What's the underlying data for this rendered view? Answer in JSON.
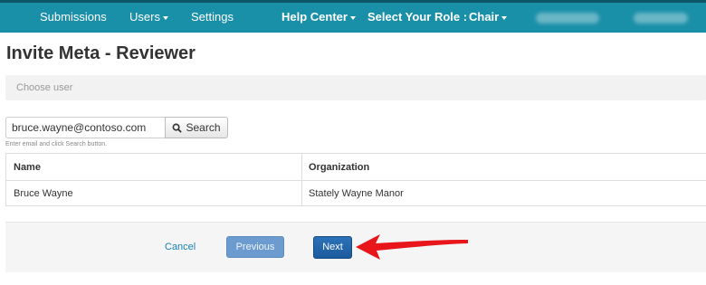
{
  "nav": {
    "submissions": "Submissions",
    "users": "Users",
    "settings": "Settings",
    "help_center": "Help Center",
    "select_role": "Select Your Role :",
    "role": "Chair"
  },
  "page": {
    "title": "Invite Meta - Reviewer"
  },
  "steps": {
    "current": "Choose user"
  },
  "search": {
    "value": "bruce.wayne@contoso.com",
    "button_label": "Search",
    "help": "Enter email and click Search button."
  },
  "table": {
    "headers": [
      "Name",
      "Organization"
    ],
    "rows": [
      [
        "Bruce Wayne",
        "Stately Wayne Manor"
      ]
    ]
  },
  "footer": {
    "cancel": "Cancel",
    "previous": "Previous",
    "next": "Next"
  },
  "colors": {
    "navbar": "#1a8fa8",
    "primary_button": "#1c5b9d",
    "annotation_arrow": "#e8151b"
  },
  "icons": {
    "search_button": "search-icon",
    "annotation": "red-arrow-icon"
  }
}
